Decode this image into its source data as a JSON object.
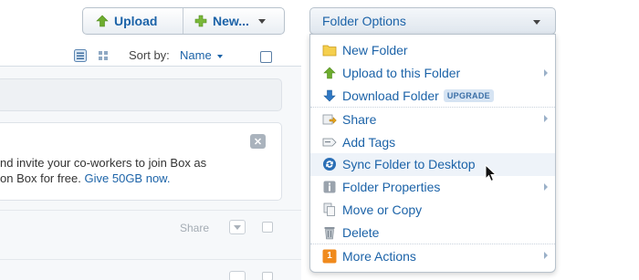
{
  "toolbar": {
    "upload_label": "Upload",
    "new_label": "New...",
    "folder_options_label": "Folder Options"
  },
  "view": {
    "sort_by_label": "Sort by:",
    "sort_by_value": "Name"
  },
  "invite": {
    "line1": "nd invite your co-workers to join Box as",
    "line2_prefix": "on Box for free.",
    "line2_link": "Give 50GB now."
  },
  "row": {
    "share_label": "Share"
  },
  "menu": {
    "items": [
      {
        "label": "New Folder",
        "icon": "folder-icon"
      },
      {
        "label": "Upload to this Folder",
        "icon": "upload-arrow-icon",
        "submenu": true
      },
      {
        "label": "Download Folder",
        "icon": "download-arrow-icon",
        "badge": "UPGRADE"
      },
      {
        "label": "Share",
        "icon": "share-icon",
        "submenu": true
      },
      {
        "label": "Add Tags",
        "icon": "tag-icon"
      },
      {
        "label": "Sync Folder to Desktop",
        "icon": "sync-icon"
      },
      {
        "label": "Folder Properties",
        "icon": "info-icon",
        "submenu": true
      },
      {
        "label": "Move or Copy",
        "icon": "copy-icon"
      },
      {
        "label": "Delete",
        "icon": "trash-icon"
      },
      {
        "label": "More Actions",
        "icon": "more-actions-icon",
        "badge_number": "1",
        "submenu": true
      }
    ]
  },
  "colors": {
    "link": "#1c63a8",
    "upload_green": "#6dac2e",
    "orange_badge": "#f08a1c"
  }
}
